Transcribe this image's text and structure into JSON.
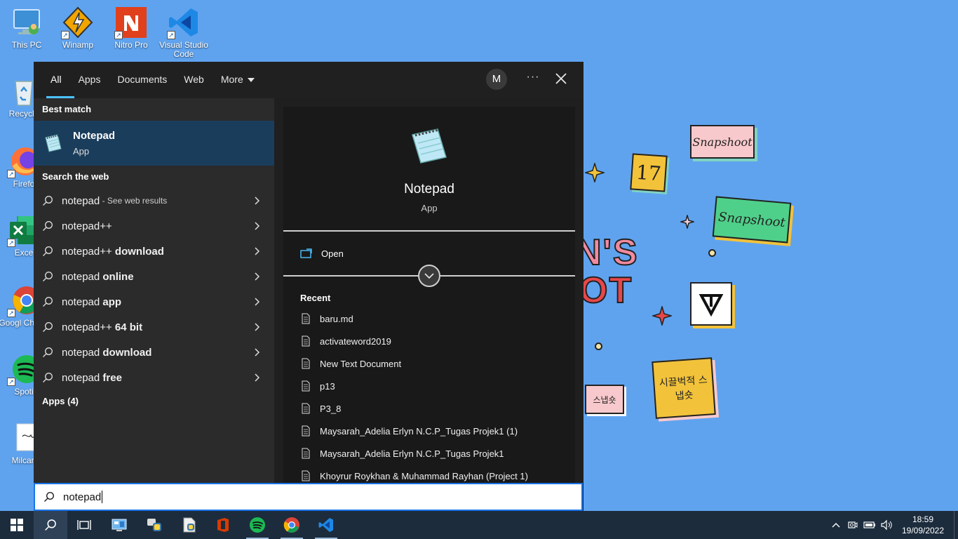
{
  "desktop": {
    "icons": [
      {
        "label": "This PC",
        "icon": "this-pc-icon"
      },
      {
        "label": "Winamp",
        "icon": "winamp-icon"
      },
      {
        "label": "Nitro Pro",
        "icon": "nitro-pro-icon"
      },
      {
        "label": "Visual Studio Code",
        "icon": "vscode-icon"
      },
      {
        "label": "Recycle",
        "icon": "recycle-bin-icon"
      },
      {
        "label": "Firefo",
        "icon": "firefox-icon"
      },
      {
        "label": "Exce",
        "icon": "excel-icon"
      },
      {
        "label": "Googl Chrom",
        "icon": "chrome-icon"
      },
      {
        "label": "Spoti",
        "icon": "spotify-icon"
      },
      {
        "label": "Milcan",
        "icon": "file-thumbnail-icon"
      }
    ],
    "wallpaper": {
      "card1": "Snapshoot",
      "card2": "Snapshoot",
      "card3": "17",
      "big_text_1": "N'S",
      "big_text_2": "OT",
      "card_pink": "스냅숏",
      "card_yellow": "시끌벅적 스냅숏"
    }
  },
  "search_panel": {
    "tabs": [
      {
        "label": "All",
        "active": true
      },
      {
        "label": "Apps"
      },
      {
        "label": "Documents"
      },
      {
        "label": "Web"
      },
      {
        "label": "More"
      }
    ],
    "avatar_initial": "M",
    "more_options": "···",
    "best_match": {
      "heading": "Best match",
      "title": "Notepad",
      "subtitle": "App"
    },
    "web": {
      "heading": "Search the web",
      "items": [
        {
          "prefix": "notepad",
          "suffix": "",
          "hint": " - See web results"
        },
        {
          "prefix": "notepad++",
          "suffix": "",
          "hint": ""
        },
        {
          "prefix": "notepad++ ",
          "suffix": "download",
          "hint": ""
        },
        {
          "prefix": "notepad ",
          "suffix": "online",
          "hint": ""
        },
        {
          "prefix": "notepad ",
          "suffix": "app",
          "hint": ""
        },
        {
          "prefix": "notepad++ ",
          "suffix": "64 bit",
          "hint": ""
        },
        {
          "prefix": "notepad ",
          "suffix": "download",
          "hint": ""
        },
        {
          "prefix": "notepad ",
          "suffix": "free",
          "hint": ""
        }
      ]
    },
    "apps_heading": "Apps (4)",
    "preview": {
      "title": "Notepad",
      "subtitle": "App",
      "open_label": "Open",
      "recent_heading": "Recent",
      "recent": [
        "baru.md",
        "activateword2019",
        "New Text Document",
        "p13",
        "P3_8",
        "Maysarah_Adelia Erlyn N.C.P_Tugas Projek1 (1)",
        "Maysarah_Adelia Erlyn N.C.P_Tugas Projek1",
        "Khoyrur Roykhan & Muhammad Rayhan (Project 1)"
      ]
    },
    "query": "notepad"
  },
  "taskbar": {
    "apps": [
      "start-icon",
      "search-icon",
      "task-view-icon",
      "control-panel-icon",
      "python-icon",
      "python-file-icon",
      "office-icon",
      "spotify-icon",
      "chrome-icon",
      "vscode-icon"
    ],
    "time": "18:59",
    "date": "19/09/2022"
  },
  "colors": {
    "accent": "#4cc2ff",
    "best_match_bg": "#1b3d5c",
    "desktop_bg": "#5fa3ef",
    "taskbar_bg": "#1c2c3d"
  }
}
